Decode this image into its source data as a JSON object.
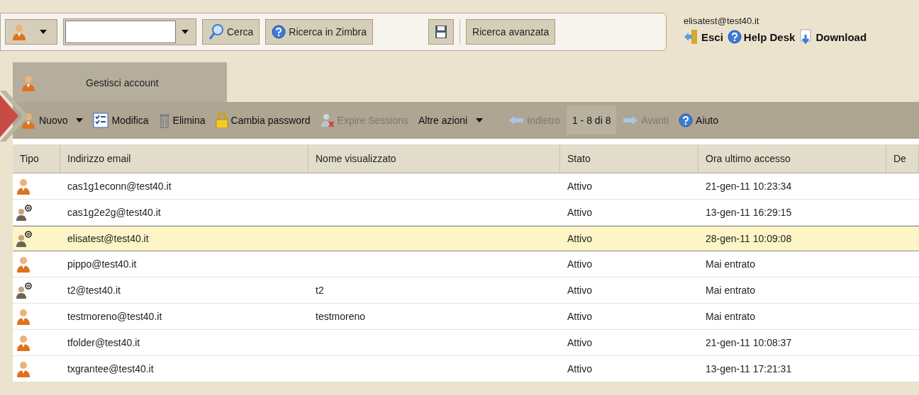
{
  "search_bar": {
    "buttons": [
      {
        "label": "Cerca"
      },
      {
        "label": "Ricerca in Zimbra"
      },
      {
        "label": "Ricerca avanzata"
      }
    ]
  },
  "user_area": {
    "email": "elisatest@test40.it",
    "links": [
      "Esci",
      "Help Desk",
      "Download"
    ]
  },
  "tabs": [
    {
      "label": "Gestisci account",
      "selected": true
    }
  ],
  "toolbar": [
    {
      "label": "Nuovo",
      "kind": "menu",
      "disabled": false
    },
    {
      "label": "Modifica",
      "kind": "button",
      "disabled": false
    },
    {
      "label": "Elimina",
      "kind": "button",
      "disabled": false
    },
    {
      "label": "Cambia password",
      "kind": "button",
      "disabled": false
    },
    {
      "label": "Expire Sessions",
      "kind": "button",
      "disabled": true
    },
    {
      "label": "Altre azioni",
      "kind": "menu",
      "disabled": false
    },
    {
      "label": "Indietro",
      "kind": "button",
      "disabled": true
    },
    {
      "label": "1 - 8 di 8",
      "kind": "count",
      "disabled": false
    },
    {
      "label": "Avanti",
      "kind": "button",
      "disabled": true
    },
    {
      "label": "Aiuto",
      "kind": "button",
      "disabled": false
    }
  ],
  "table": {
    "columns": [
      "Tipo",
      "Indirizzo email",
      "Nome visualizzato",
      "Stato",
      "Ora ultimo accesso",
      "De"
    ],
    "rows": [
      {
        "kind": "account",
        "selected": false,
        "email": "cas1g1econn@test40.it",
        "status": "Attivo",
        "last_login": "21-gen-11 10:23:34"
      },
      {
        "kind": "alias",
        "selected": false,
        "email": "cas1g2e2g@test40.it",
        "status": "Attivo",
        "last_login": "13-gen-11 16:29:15"
      },
      {
        "kind": "alias",
        "selected": true,
        "email": "elisatest@test40.it",
        "status": "Attivo",
        "last_login": "28-gen-11 10:09:08"
      },
      {
        "kind": "account",
        "selected": false,
        "email": "pippo@test40.it",
        "status": "Attivo",
        "last_login": "Mai entrato"
      },
      {
        "kind": "alias",
        "selected": false,
        "email": "t2@test40.it",
        "name": "t2",
        "status": "Attivo",
        "last_login": "Mai entrato"
      },
      {
        "kind": "account",
        "selected": false,
        "email": "testmoreno@test40.it",
        "name": "testmoreno",
        "status": "Attivo",
        "last_login": "Mai entrato"
      },
      {
        "kind": "account",
        "selected": false,
        "email": "tfolder@test40.it",
        "status": "Attivo",
        "last_login": "21-gen-11 10:08:37"
      },
      {
        "kind": "account",
        "selected": false,
        "email": "txgrantee@test40.it",
        "status": "Attivo",
        "last_login": "13-gen-11 17:21:31"
      }
    ]
  }
}
